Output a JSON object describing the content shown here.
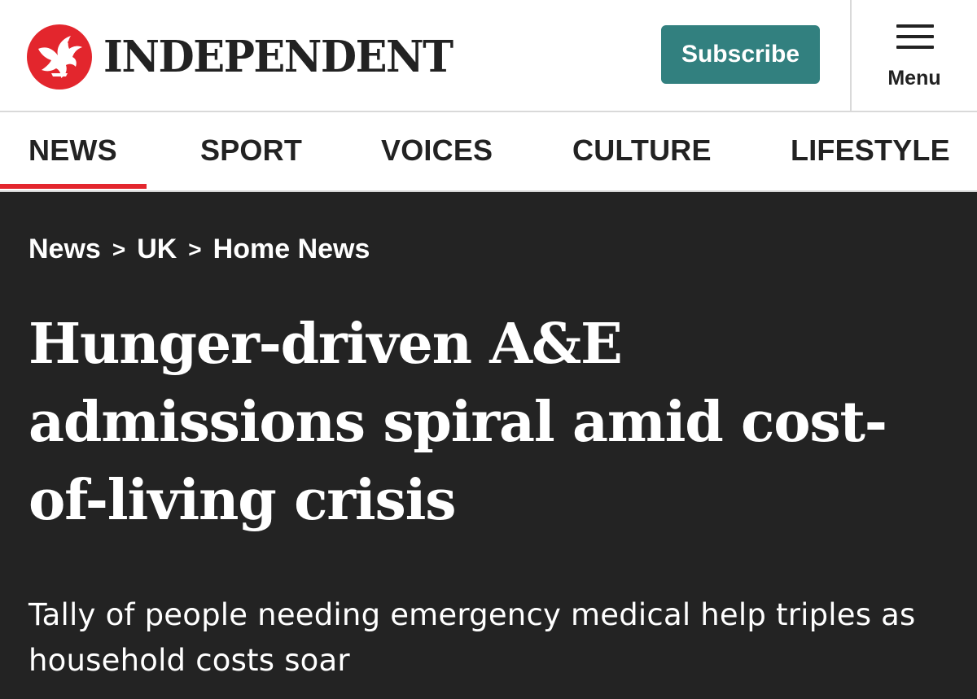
{
  "header": {
    "logo_text": "INDEPENDENT",
    "subscribe_label": "Subscribe",
    "menu_label": "Menu",
    "brand_red": "#e3262d",
    "subscribe_color": "#32807f",
    "logo_icon": "eagle-icon",
    "menu_icon": "hamburger-icon"
  },
  "nav": {
    "items": [
      {
        "label": "NEWS"
      },
      {
        "label": "SPORT"
      },
      {
        "label": "VOICES"
      },
      {
        "label": "CULTURE"
      },
      {
        "label": "LIFESTYLE"
      }
    ],
    "active": "NEWS"
  },
  "article": {
    "breadcrumb": [
      "News",
      "UK",
      "Home News"
    ],
    "breadcrumb_separator": ">",
    "headline": "Hunger-driven A&E admissions spiral amid cost-of-living crisis",
    "standfirst": "Tally of people needing emergency medical help triples as household costs soar",
    "background_color": "#232323"
  }
}
